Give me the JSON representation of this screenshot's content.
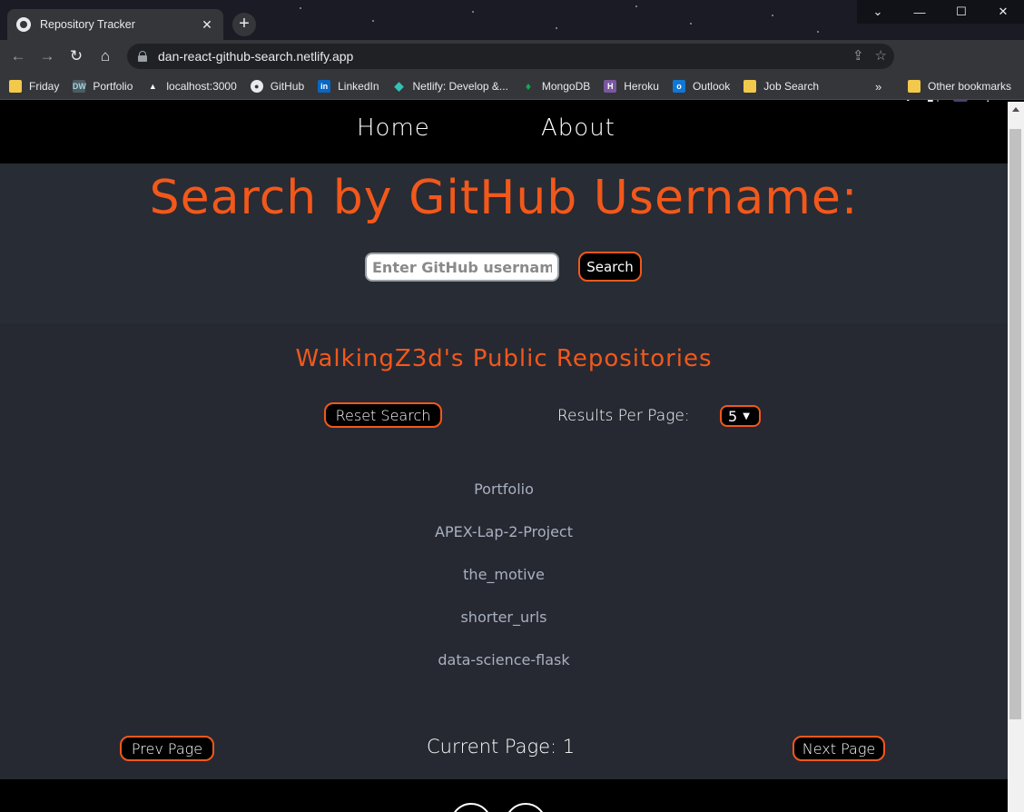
{
  "browser": {
    "tab_title": "Repository Tracker",
    "url": "dan-react-github-search.netlify.app",
    "bookmarks": [
      {
        "label": "Friday",
        "icon": "folder-icon"
      },
      {
        "label": "Portfolio",
        "icon": "dw-icon"
      },
      {
        "label": "localhost:3000",
        "icon": "triangle-icon"
      },
      {
        "label": "GitHub",
        "icon": "github-icon"
      },
      {
        "label": "LinkedIn",
        "icon": "linkedin-icon"
      },
      {
        "label": "Netlify: Develop &...",
        "icon": "netlify-icon"
      },
      {
        "label": "MongoDB",
        "icon": "mongodb-icon"
      },
      {
        "label": "Heroku",
        "icon": "heroku-icon"
      },
      {
        "label": "Outlook",
        "icon": "outlook-icon"
      },
      {
        "label": "Job Search",
        "icon": "folder-icon"
      }
    ],
    "more_label": "»",
    "other_bookmarks": "Other bookmarks"
  },
  "nav": {
    "home": "Home",
    "about": "About"
  },
  "hero": {
    "title": "Search by GitHub Username:",
    "input_placeholder": "Enter GitHub username",
    "search_button": "Search"
  },
  "results": {
    "heading": "WalkingZ3d's Public Repositories",
    "reset_button": "Reset Search",
    "per_page_label": "Results Per Page:",
    "per_page_value": "5",
    "repos": [
      "Portfolio",
      "APEX-Lap-2-Project",
      "the_motive",
      "shorter_urls",
      "data-science-flask"
    ],
    "prev_button": "Prev Page",
    "current_page": "Current Page: 1",
    "next_button": "Next Page"
  },
  "colors": {
    "accent": "#f2581b",
    "page_bg": "#282c34",
    "nav_bg": "#000000"
  }
}
